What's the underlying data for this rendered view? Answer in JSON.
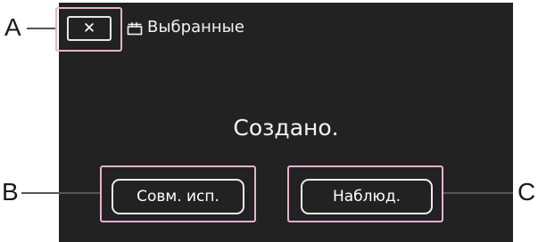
{
  "callouts": {
    "a": "A",
    "b": "B",
    "c": "C"
  },
  "header": {
    "close_label": "✕",
    "title": "Выбранные",
    "title_icon": "clapperboard-icon"
  },
  "dialog": {
    "message": "Создано."
  },
  "actions": {
    "share_label": "Совм. исп.",
    "watch_label": "Наблюд."
  },
  "colors": {
    "screen_background": "#222222",
    "button_border": "#ececec",
    "callout_highlight": "#e3b3cf"
  }
}
